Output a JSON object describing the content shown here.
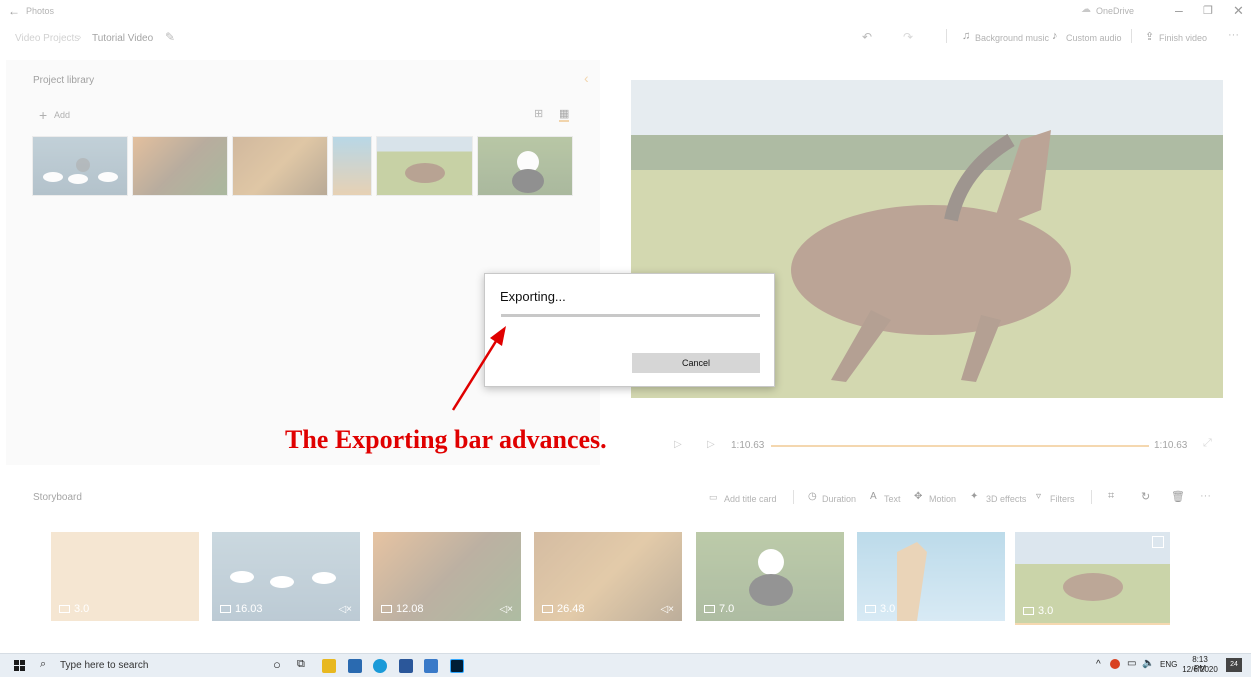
{
  "titlebar": {
    "app": "Photos",
    "breadcrumb_root": "Video Projects",
    "breadcrumb_current": "Tutorial Video",
    "onedrive": "OneDrive",
    "bg_music": "Background music",
    "custom_audio": "Custom audio",
    "finish_video": "Finish video"
  },
  "library": {
    "title": "Project library",
    "add_label": "Add"
  },
  "playback": {
    "current_time": "1:10.63",
    "total_time": "1:10.63"
  },
  "storyboard": {
    "title": "Storyboard",
    "add_title_card": "Add title card",
    "duration": "Duration",
    "text": "Text",
    "motion": "Motion",
    "effects_3d": "3D effects",
    "filters": "Filters",
    "cards": [
      {
        "duration": "3.0"
      },
      {
        "duration": "16.03"
      },
      {
        "duration": "12.08"
      },
      {
        "duration": "26.48"
      },
      {
        "duration": "7.0"
      },
      {
        "duration": "3.0"
      },
      {
        "duration": "3.0"
      }
    ]
  },
  "dialog": {
    "title": "Exporting...",
    "cancel_label": "Cancel",
    "progress": 0.0
  },
  "annotation": {
    "text": "The Exporting bar advances."
  },
  "taskbar": {
    "search_placeholder": "Type here to search",
    "lang": "ENG",
    "time": "8:13 PM",
    "date": "12/6/2020",
    "notif_count": "24"
  },
  "colors": {
    "accent": "#e8a850",
    "annotation": "#e00000",
    "title_card": "#e8c89a"
  }
}
